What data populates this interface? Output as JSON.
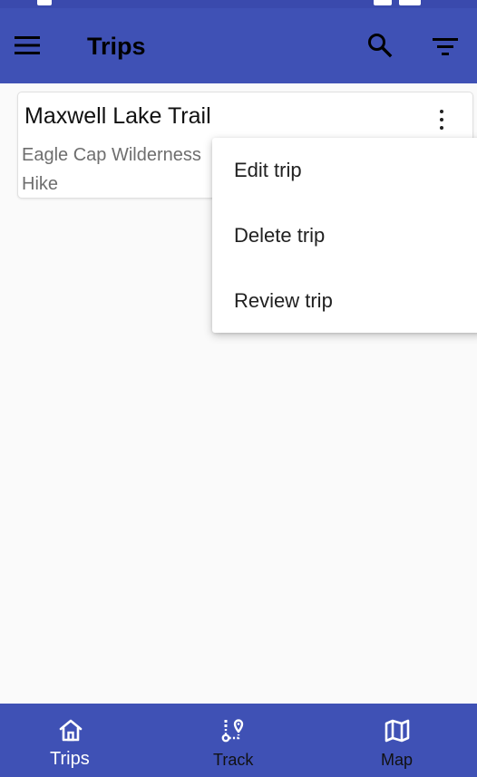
{
  "toolbar": {
    "title": "Trips",
    "menu_icon": "hamburger-menu-icon",
    "search_icon": "search-icon",
    "filter_icon": "filter-icon"
  },
  "trips": [
    {
      "name": "Maxwell Lake Trail",
      "location": "Eagle Cap Wilderness",
      "type": "Hike"
    }
  ],
  "popup_menu": {
    "items": [
      {
        "label": "Edit trip"
      },
      {
        "label": "Delete trip"
      },
      {
        "label": "Review trip"
      }
    ]
  },
  "bottom_nav": {
    "items": [
      {
        "label": "Trips",
        "icon": "home-icon",
        "selected": true
      },
      {
        "label": "Track",
        "icon": "route-icon",
        "selected": false
      },
      {
        "label": "Map",
        "icon": "map-icon",
        "selected": false
      }
    ]
  },
  "colors": {
    "primary": "#3f51b5",
    "background": "#fafafa",
    "nav_selected": "#ffffff",
    "nav_unselected": "#111111"
  }
}
